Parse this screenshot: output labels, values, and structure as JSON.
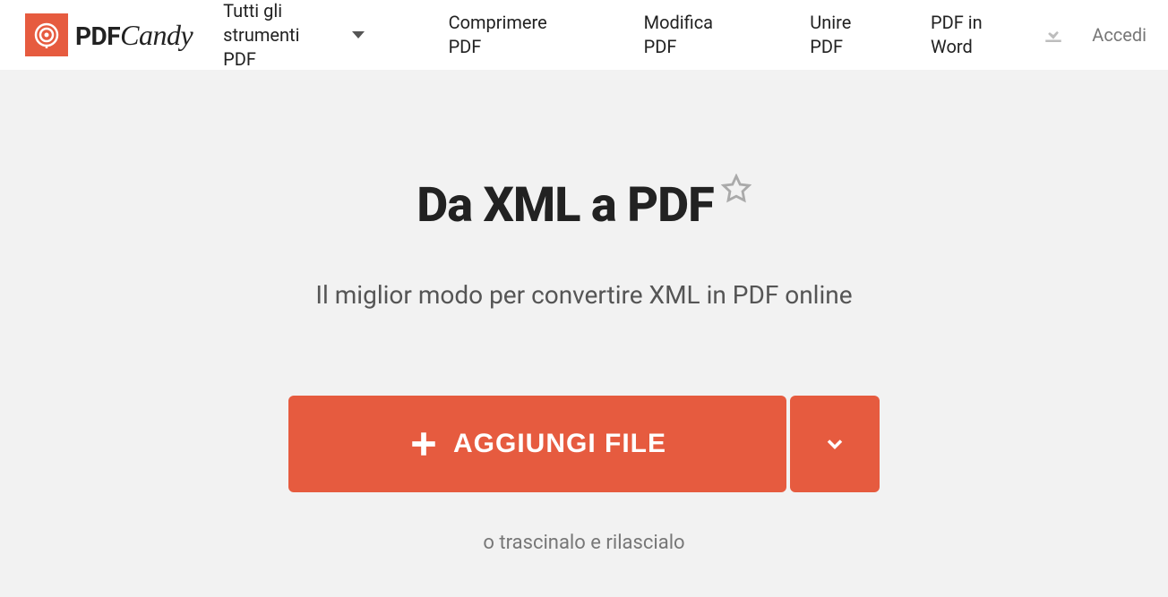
{
  "header": {
    "logo_pdf": "PDF",
    "logo_candy": "Candy",
    "nav": {
      "all_tools": "Tutti gli strumenti PDF",
      "compress": "Comprimere PDF",
      "edit": "Modifica PDF",
      "merge": "Unire PDF",
      "to_word": "PDF in Word"
    },
    "login": "Accedi"
  },
  "main": {
    "title": "Da XML a PDF",
    "subtitle": "Il miglior modo per convertire XML in PDF online",
    "add_file": "AGGIUNGI FILE",
    "drop_hint": "o trascinalo e rilascialo"
  }
}
